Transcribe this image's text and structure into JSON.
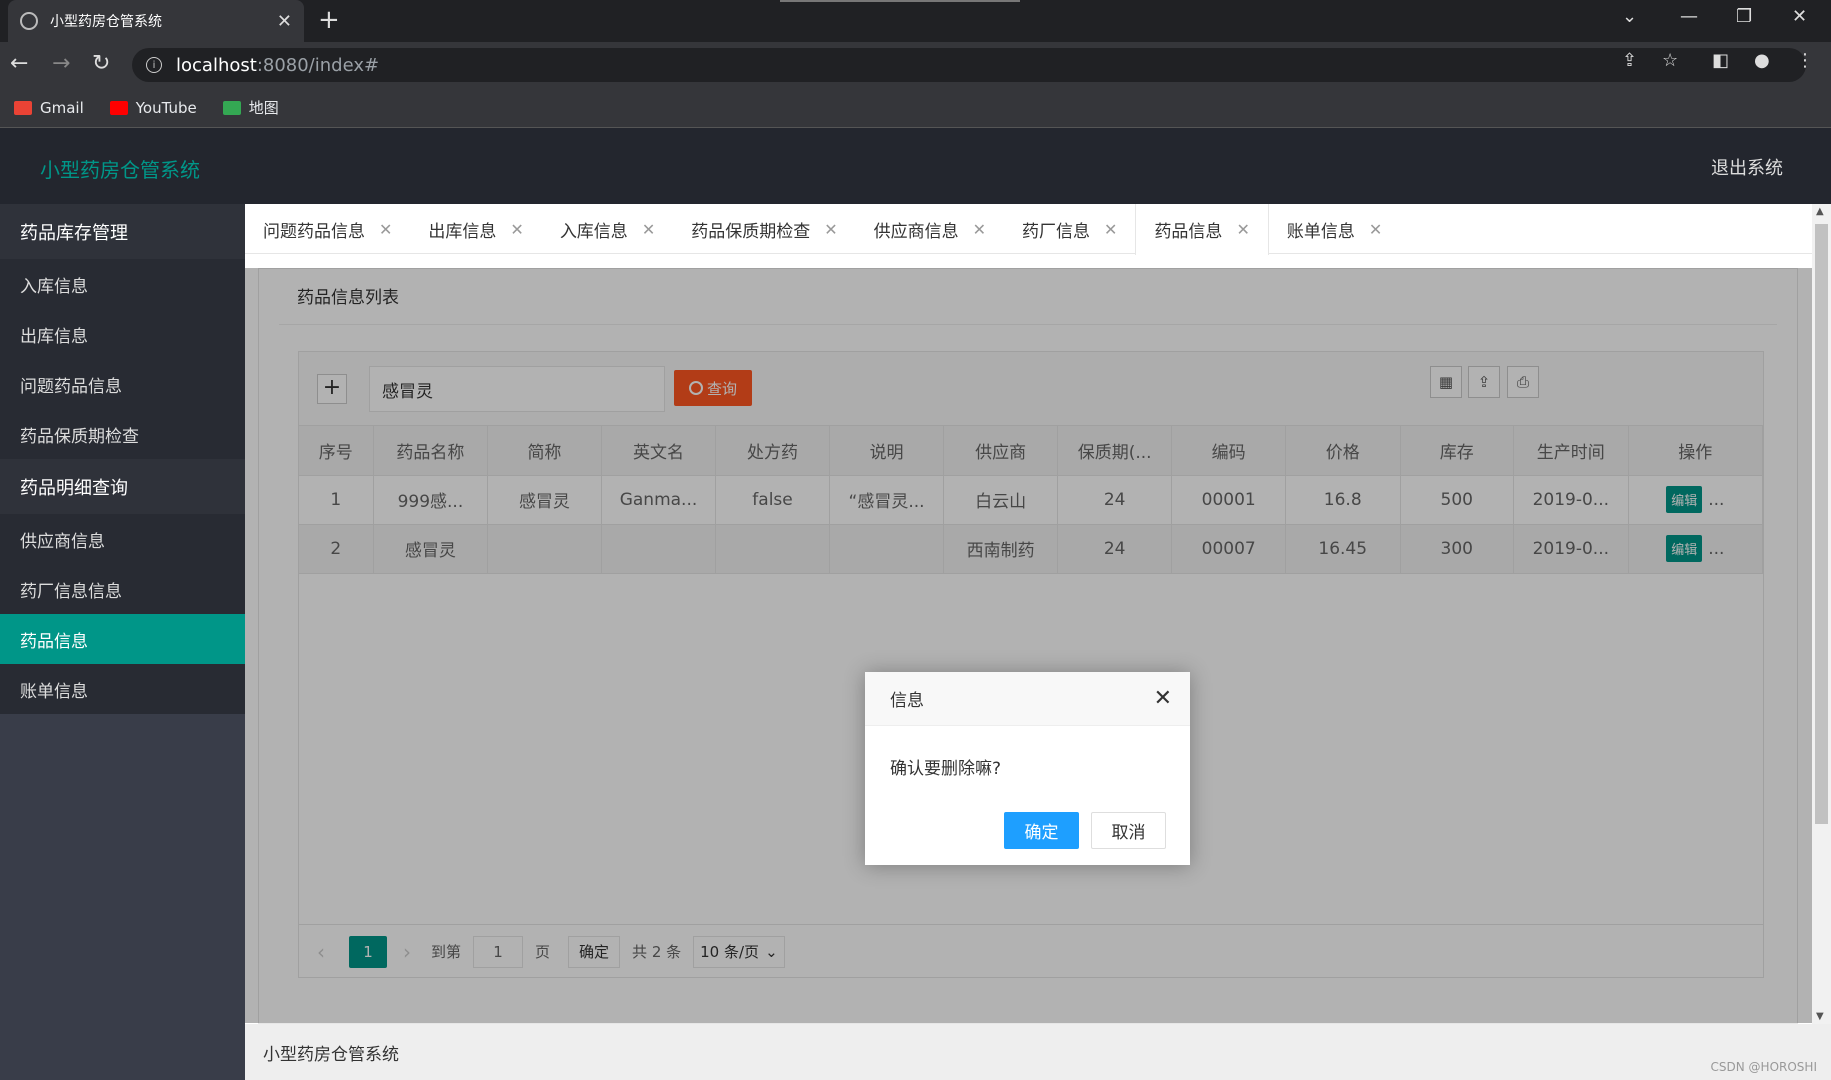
{
  "browser": {
    "tab_title": "小型药房仓管系统",
    "address_host": "localhost",
    "address_path": ":8080/index#",
    "bookmarks": [
      "Gmail",
      "YouTube",
      "地图"
    ]
  },
  "header": {
    "app_title": "小型药房仓管系统",
    "logout": "退出系统"
  },
  "sidebar": {
    "groups": [
      {
        "title": "药品库存管理",
        "items": [
          "入库信息",
          "出库信息",
          "问题药品信息",
          "药品保质期检查"
        ]
      },
      {
        "title": "药品明细查询",
        "items": [
          "供应商信息",
          "药厂信息信息",
          "药品信息",
          "账单信息"
        ]
      }
    ],
    "active_item": "药品信息"
  },
  "page_tabs": [
    "问题药品信息",
    "出库信息",
    "入库信息",
    "药品保质期检查",
    "供应商信息",
    "药厂信息",
    "药品信息",
    "账单信息"
  ],
  "active_tab": "药品信息",
  "panel": {
    "title": "药品信息列表",
    "search_value": "感冒灵",
    "query_button": "查询",
    "add_symbol": "+"
  },
  "table": {
    "columns": [
      "序号",
      "药品名称",
      "简称",
      "英文名",
      "处方药",
      "说明",
      "供应商",
      "保质期(...",
      "编码",
      "价格",
      "库存",
      "生产时间",
      "操作"
    ],
    "rows": [
      [
        "1",
        "999感...",
        "感冒灵",
        "Ganma...",
        "false",
        "“感冒灵...",
        "白云山",
        "24",
        "00001",
        "16.8",
        "500",
        "2019-0..."
      ],
      [
        "2",
        "感冒灵",
        "",
        "",
        "",
        "",
        "西南制药",
        "24",
        "00007",
        "16.45",
        "300",
        "2019-0..."
      ]
    ],
    "edit_label": "编辑",
    "more_label": "..."
  },
  "pager": {
    "current": "1",
    "goto_label": "到第",
    "goto_value": "1",
    "page_label": "页",
    "ok_label": "确定",
    "total": "共 2 条",
    "page_size": "10 条/页"
  },
  "footer": {
    "text": "小型药房仓管系统"
  },
  "dialog": {
    "title": "信息",
    "message": "确认要删除嘛?",
    "ok": "确定",
    "cancel": "取消"
  },
  "watermark": "CSDN @HOROSHI",
  "colors": {
    "accent": "#009688",
    "query": "#ff5722",
    "dialog_ok": "#1e9fff",
    "header_bg": "#23262e",
    "sidebar_bg": "#393d49"
  }
}
